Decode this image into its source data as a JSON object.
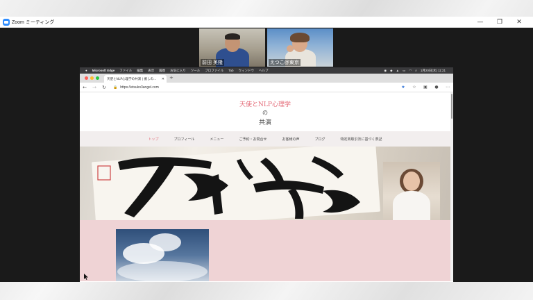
{
  "zoom": {
    "window_title": "Zoom ミーティング",
    "window_controls": [
      "—",
      "❐",
      "✕"
    ]
  },
  "participants": [
    {
      "name": "前田 英隆"
    },
    {
      "name": "えつこ@東京"
    }
  ],
  "mac_menubar": {
    "app": "Microsoft Edge",
    "menus": [
      "ファイル",
      "編集",
      "表示",
      "履歴",
      "お気に入り",
      "ツール",
      "プロファイル",
      "Tab",
      "ウィンドウ",
      "ヘルプ"
    ],
    "clock": "1月20日(水) 11:21"
  },
  "browser": {
    "tab_title": "天使とNLP心理学の共演 | 癒しの...",
    "url": "https://etsuko3angel.com"
  },
  "site": {
    "title_line1": "天使とNLP心理学",
    "title_line2": "の",
    "title_line3": "共演",
    "nav": [
      "トップ",
      "プロフィール",
      "メニュー",
      "ご予約・お問合せ",
      "お客様の声",
      "ブログ",
      "特定商取引法に基づく表記"
    ],
    "active_nav": "トップ"
  },
  "colors": {
    "accent": "#e46b78",
    "zoom_blue": "#2d8cff",
    "pink_section": "#efd3d5"
  }
}
